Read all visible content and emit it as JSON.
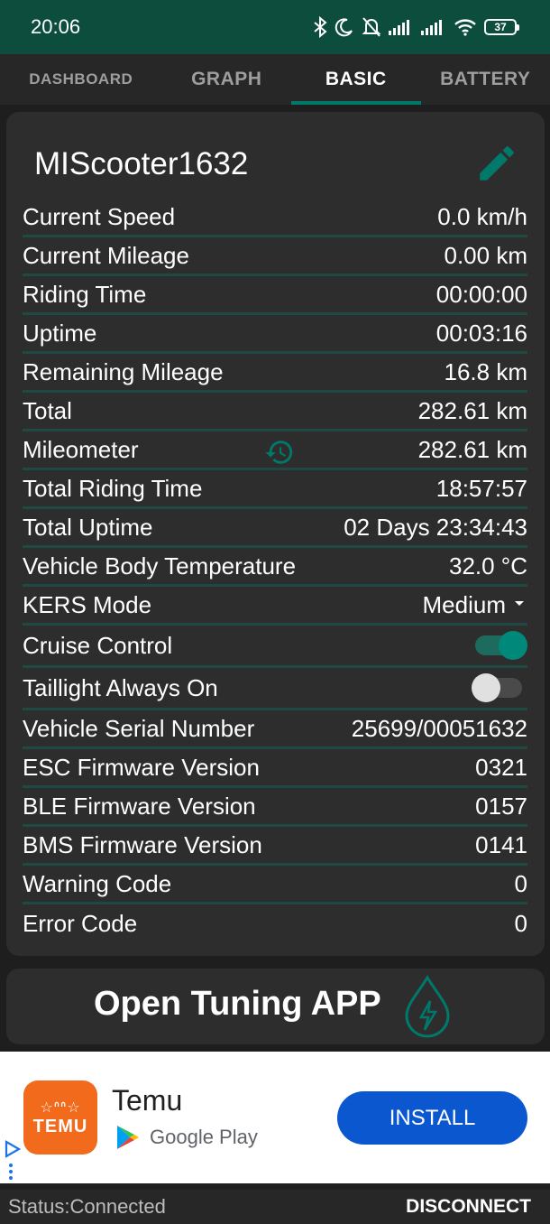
{
  "status_bar": {
    "time": "20:06",
    "battery_level": "37",
    "icons": [
      "bluetooth-icon",
      "moon-icon",
      "bell-off-icon",
      "signal-icon",
      "signal-icon",
      "wifi-icon",
      "battery-icon"
    ]
  },
  "tabs": [
    {
      "label": "DASHBOARD",
      "active": false
    },
    {
      "label": "GRAPH",
      "active": false
    },
    {
      "label": "BASIC",
      "active": true
    },
    {
      "label": "BATTERY",
      "active": false
    }
  ],
  "device": {
    "name": "MIScooter1632",
    "edit_icon": "pencil-icon"
  },
  "rows": {
    "current_speed": {
      "label": "Current Speed",
      "value": "0.0 km/h"
    },
    "current_mileage": {
      "label": "Current Mileage",
      "value": "0.00 km"
    },
    "riding_time": {
      "label": "Riding Time",
      "value": "00:00:00"
    },
    "uptime": {
      "label": "Uptime",
      "value": "00:03:16"
    },
    "remaining_mileage": {
      "label": "Remaining Mileage",
      "value": "16.8 km"
    },
    "total": {
      "label": "Total",
      "value": "282.61 km"
    },
    "mileometer": {
      "label": "Mileometer",
      "value": "282.61 km",
      "icon": "history-icon"
    },
    "total_riding_time": {
      "label": "Total Riding Time",
      "value": "18:57:57"
    },
    "total_uptime": {
      "label": "Total Uptime",
      "value": "02 Days 23:34:43"
    },
    "body_temperature": {
      "label": "Vehicle Body Temperature",
      "value": "32.0 °C"
    },
    "kers_mode": {
      "label": "KERS Mode",
      "value": "Medium"
    },
    "cruise_control": {
      "label": "Cruise Control",
      "enabled": true
    },
    "taillight": {
      "label": "Taillight Always On",
      "enabled": false
    },
    "serial_number": {
      "label": "Vehicle Serial Number",
      "value": "25699/00051632"
    },
    "esc_firmware": {
      "label": "ESC Firmware Version",
      "value": "0321"
    },
    "ble_firmware": {
      "label": "BLE Firmware Version",
      "value": "0157"
    },
    "bms_firmware": {
      "label": "BMS Firmware Version",
      "value": "0141"
    },
    "warning_code": {
      "label": "Warning Code",
      "value": "0"
    },
    "error_code": {
      "label": "Error Code",
      "value": "0"
    }
  },
  "tuning": {
    "label": "Open Tuning APP",
    "icon": "water-drop-bolt-icon"
  },
  "ad": {
    "app_name": "Temu",
    "logo_text": "TEMU",
    "store": "Google Play",
    "install_label": "INSTALL"
  },
  "bottom_bar": {
    "status": "Status:Connected",
    "disconnect_label": "DISCONNECT"
  },
  "colors": {
    "accent": "#00897b",
    "status_bar": "#0d4d3e",
    "card": "#2d2d2d",
    "divider": "#1f4a44",
    "install_button": "#0b57d0",
    "temu_orange": "#f26a1b"
  }
}
